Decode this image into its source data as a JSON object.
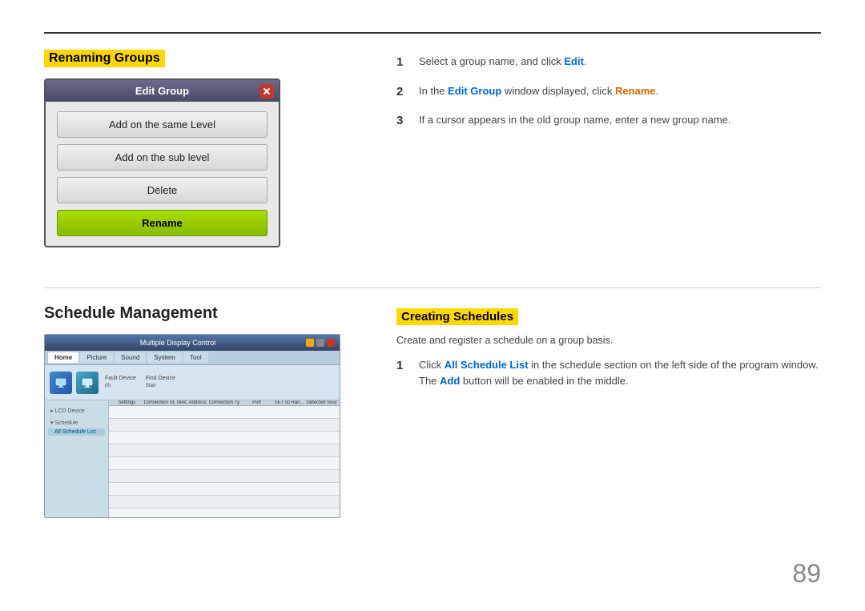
{
  "page": {
    "number": "89"
  },
  "top_section": {
    "heading": "Renaming Groups",
    "dialog": {
      "title": "Edit Group",
      "buttons": {
        "same_level": "Add on the same Level",
        "sub_level": "Add on the sub level",
        "delete": "Delete",
        "rename": "Rename"
      }
    },
    "steps": [
      {
        "num": "1",
        "text_before": "Select a group name, and click ",
        "link": "Edit",
        "link_color": "blue",
        "text_after": "."
      },
      {
        "num": "2",
        "text_before": "In the ",
        "link1": "Edit Group",
        "link1_color": "blue",
        "text_mid": " window displayed, click ",
        "link2": "Rename",
        "link2_color": "orange",
        "text_after": "."
      },
      {
        "num": "3",
        "text": "If a cursor appears in the old group name, enter a new group name."
      }
    ]
  },
  "bottom_section": {
    "left_heading": "Schedule Management",
    "right_heading": "Creating Schedules",
    "subtitle": "Create and register a schedule on a group basis.",
    "screenshot": {
      "title": "Multiple Display Control",
      "tabs": [
        "Home",
        "Picture",
        "Sound",
        "System",
        "Tool"
      ],
      "sidebar_groups": [
        "LCD Device",
        "Schedule"
      ],
      "sidebar_items": [
        "All Schedule List"
      ],
      "columns": [
        "Settings",
        "Connection Status",
        "MAC Address",
        "Connection Type",
        "Port",
        "SET ID Ran...",
        "Detected Sources"
      ]
    },
    "steps": [
      {
        "num": "1",
        "text_before": "Click ",
        "link": "All Schedule List",
        "link_color": "blue",
        "text_mid": " in the schedule section on the left side of the program window. The ",
        "link2": "Add",
        "link2_color": "blue",
        "text_after": " button will be enabled in the middle."
      }
    ]
  }
}
